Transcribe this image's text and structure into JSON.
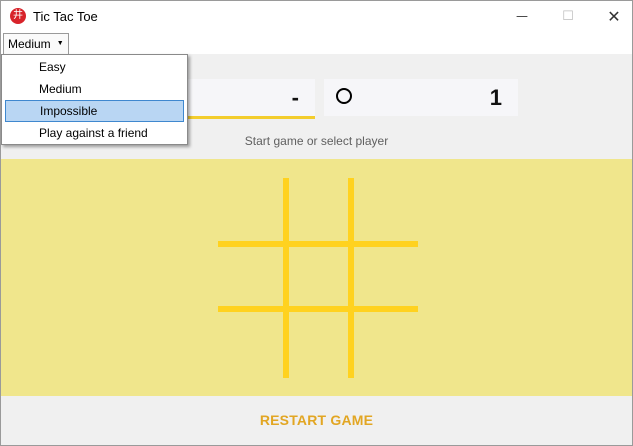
{
  "window": {
    "title": "Tic Tac Toe",
    "app_icon_glyph": "井",
    "controls": {
      "minimize": "—",
      "maximize": "☐",
      "close": "✕"
    }
  },
  "menubar": {
    "difficulty_selected": "Medium",
    "caret_icon": "chevron-down-icon",
    "options": [
      "Easy",
      "Medium",
      "Impossible",
      "Play against a friend"
    ],
    "highlighted_option": "Impossible"
  },
  "scoreboard": {
    "x_score": "-",
    "o_score": "1",
    "active_player": "x"
  },
  "status_text": "Start game or select player",
  "restart_label": "RESTART GAME",
  "colors": {
    "board_background": "#f0e68c",
    "grid_lines": "#ffd21f",
    "active_underline": "#f3cd2d",
    "restart_text": "#e2a623",
    "highlight_bg": "#b9d6f3",
    "highlight_border": "#3f88cf"
  }
}
